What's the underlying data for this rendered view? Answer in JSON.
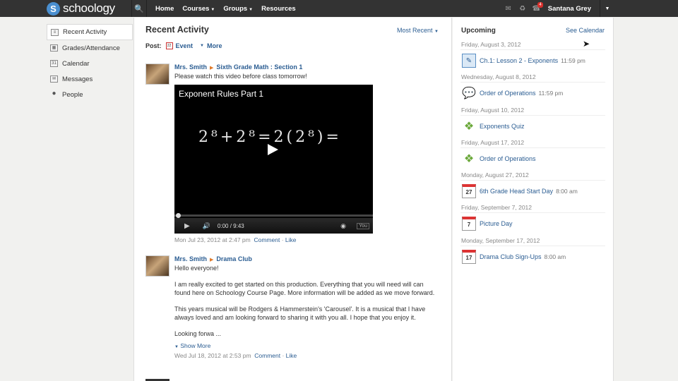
{
  "header": {
    "logo_text": "schoology",
    "nav": [
      {
        "label": "Home"
      },
      {
        "label": "Courses"
      },
      {
        "label": "Groups"
      },
      {
        "label": "Resources"
      }
    ],
    "notification_count": "4",
    "user_name": "Santana Grey"
  },
  "sidebar": {
    "items": [
      {
        "label": "Recent Activity",
        "icon": "feed-icon"
      },
      {
        "label": "Grades/Attendance",
        "icon": "grades-icon"
      },
      {
        "label": "Calendar",
        "icon": "calendar-icon"
      },
      {
        "label": "Messages",
        "icon": "messages-icon"
      },
      {
        "label": "People",
        "icon": "people-icon"
      }
    ]
  },
  "main": {
    "title": "Recent Activity",
    "sort_label": "Most Recent",
    "post_label": "Post:",
    "post_event": "Event",
    "post_more": "More",
    "posts": [
      {
        "author": "Mrs. Smith",
        "target": "Sixth Grade Math : Section 1",
        "text": "Please watch this video before class tomorrow!",
        "video": {
          "title": "Exponent Rules Part 1",
          "time": "0:00 / 9:43"
        },
        "date": "Mon Jul 23, 2012 at 2:47 pm",
        "comment": "Comment",
        "like": "Like"
      },
      {
        "author": "Mrs. Smith",
        "target": "Drama Club",
        "greeting": "Hello everyone!",
        "para1": "I am really excited to get started on this production. Everything that you will need will can found here on Schoology Course Page. More information will be added as we move forward.",
        "para2": "This years musical will be Rodgers & Hammerstein's 'Carousel'. It is a musical that I have always loved and am looking forward to sharing it with you all. I hope that you enjoy it.",
        "para3": "Looking forwa ...",
        "show_more": "Show More",
        "date": "Wed Jul 18, 2012 at 2:53 pm",
        "comment": "Comment",
        "like": "Like"
      }
    ]
  },
  "upcoming": {
    "title": "Upcoming",
    "see_calendar": "See Calendar",
    "groups": [
      {
        "date": "Friday, August 3, 2012",
        "title": "Ch.1: Lesson 2 - Exponents",
        "time": "11:59 pm",
        "type": "assignment",
        "icon": "assignment-icon"
      },
      {
        "date": "Wednesday, August 8, 2012",
        "title": "Order of Operations",
        "time": "11:59 pm",
        "type": "discussion",
        "icon": "discussion-icon"
      },
      {
        "date": "Friday, August 10, 2012",
        "title": "Exponents Quiz",
        "time": "",
        "type": "quiz",
        "icon": "quiz-icon"
      },
      {
        "date": "Friday, August 17, 2012",
        "title": "Order of Operations",
        "time": "",
        "type": "quiz",
        "icon": "quiz-icon"
      },
      {
        "date": "Monday, August 27, 2012",
        "title": "6th Grade Head Start Day",
        "time": "8:00 am",
        "type": "event",
        "day": "27",
        "icon": "calendar-event-icon"
      },
      {
        "date": "Friday, September 7, 2012",
        "title": "Picture Day",
        "time": "",
        "type": "event",
        "day": "7",
        "icon": "calendar-event-icon"
      },
      {
        "date": "Monday, September 17, 2012",
        "title": "Drama Club Sign-Ups",
        "time": "8:00 am",
        "type": "event",
        "day": "17",
        "icon": "calendar-event-icon"
      }
    ]
  },
  "colors": {
    "topbar": "#333333",
    "link": "#2b5d92",
    "accent": "#4a8fd0"
  }
}
